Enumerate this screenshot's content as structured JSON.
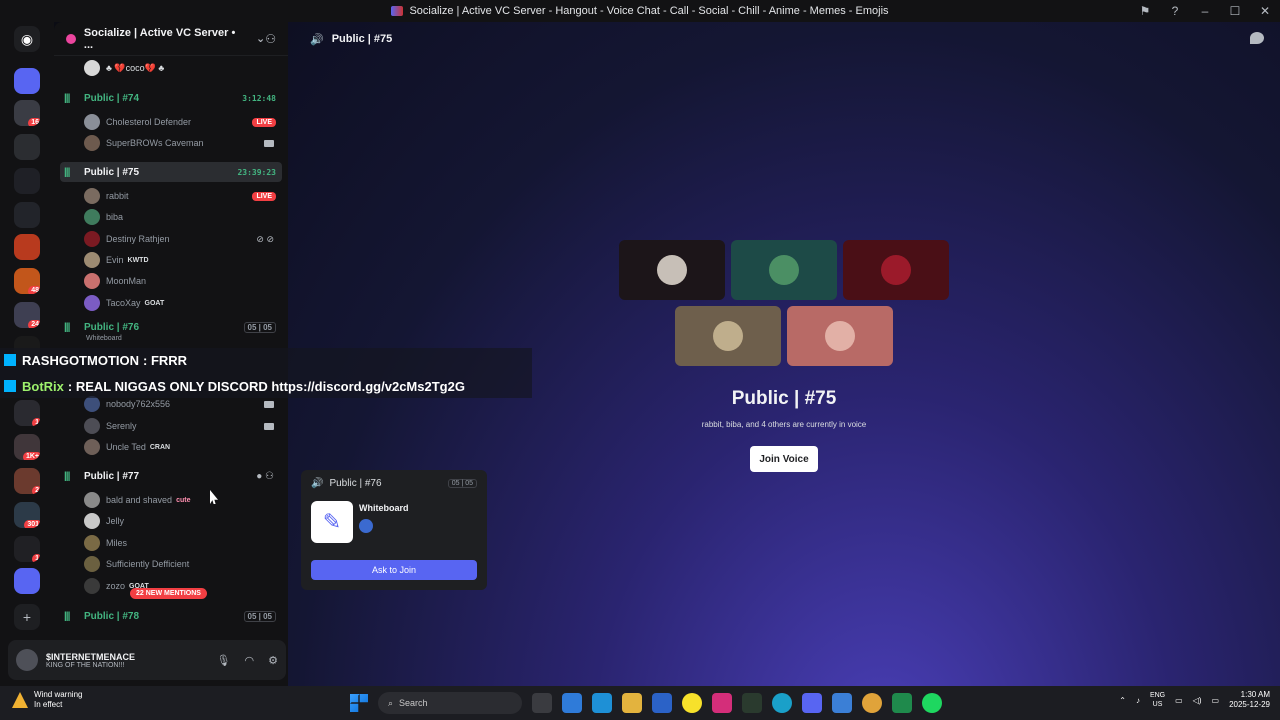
{
  "window": {
    "title": "Socialize | Active VC Server - Hangout - Voice Chat - Call - Social - Chill - Anime - Memes - Emojis"
  },
  "rail": {
    "badges": [
      "16",
      "48",
      "24",
      "1",
      "1K+",
      "2",
      "301",
      "1"
    ]
  },
  "server": {
    "name": "Socialize | Active VC Server • ..."
  },
  "sidebar": {
    "top_member": "♣ 💔coco💔 ♣",
    "channels": [
      {
        "name": "Public | #74",
        "timer": "3:12:48",
        "members": [
          {
            "name": "Cholesterol Defender",
            "live": "LIVE"
          },
          {
            "name": "SuperBROWs Caveman"
          }
        ]
      },
      {
        "name": "Public | #75",
        "timer": "23:39:23",
        "members": [
          {
            "name": "rabbit",
            "live": "LIVE"
          },
          {
            "name": "biba"
          },
          {
            "name": "Destiny Rathjen"
          },
          {
            "name": "Evin",
            "tag": "KWTD"
          },
          {
            "name": "MoonMan"
          },
          {
            "name": "TacoXay",
            "tag": "GOAT"
          }
        ]
      },
      {
        "name": "Public | #76",
        "count": "05 | 05",
        "sub": "Whiteboard",
        "members": [
          {
            "name": "nobody762x556"
          },
          {
            "name": "Serenly"
          },
          {
            "name": "Uncle Ted",
            "tag": "CRAN"
          }
        ]
      },
      {
        "name": "Public | #77",
        "members": [
          {
            "name": "bald and shaved",
            "tag": "cute"
          },
          {
            "name": "Jelly"
          },
          {
            "name": "Miles"
          },
          {
            "name": "Sufficiently Defficient"
          },
          {
            "name": "zozo",
            "tag": "GOAT"
          }
        ]
      },
      {
        "name": "Public | #78",
        "count": "05 | 05"
      }
    ],
    "new_mentions": "22 NEW MENTIONS"
  },
  "user": {
    "name": "$INTERNETMENACE",
    "status": "KING OF THE NATION!!!"
  },
  "main": {
    "header": "Public | #75",
    "title": "Public | #75",
    "subtitle": "rabbit, biba, and 4 others are currently in voice",
    "join_label": "Join Voice"
  },
  "popout": {
    "channel": "Public | #76",
    "count": "05 | 05",
    "app_name": "Whiteboard",
    "ask_label": "Ask to Join"
  },
  "overlay": {
    "line1_user": "RASHGOTMOTION",
    "line1_text": ": FRRR",
    "line2_user": "BotRix",
    "line2_text": ": REAL NIGGAS ONLY DISCORD https://discord.gg/v2cMs2Tg2G"
  },
  "taskbar": {
    "weather_title": "Wind warning",
    "weather_sub": "In effect",
    "search_placeholder": "Search",
    "lang_1": "ENG",
    "lang_2": "US",
    "time": "1:30 AM",
    "date": "2025-12-29"
  },
  "colors": {
    "blurple": "#5865f2",
    "voice_green": "#43b581",
    "live_red": "#f23f43"
  }
}
